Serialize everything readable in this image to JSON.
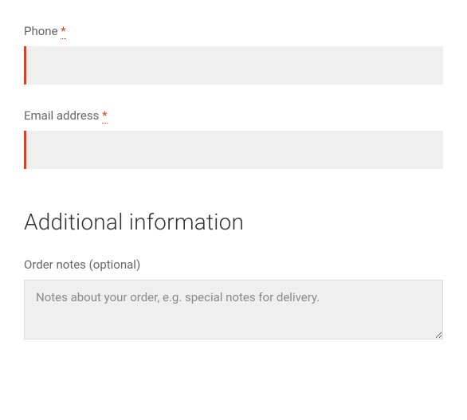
{
  "fields": {
    "phone": {
      "label": "Phone",
      "required_mark": "*"
    },
    "email": {
      "label": "Email address",
      "required_mark": "*"
    },
    "order_notes": {
      "label": "Order notes (optional)",
      "placeholder": "Notes about your order, e.g. special notes for delivery."
    }
  },
  "section": {
    "additional_info_heading": "Additional information"
  }
}
